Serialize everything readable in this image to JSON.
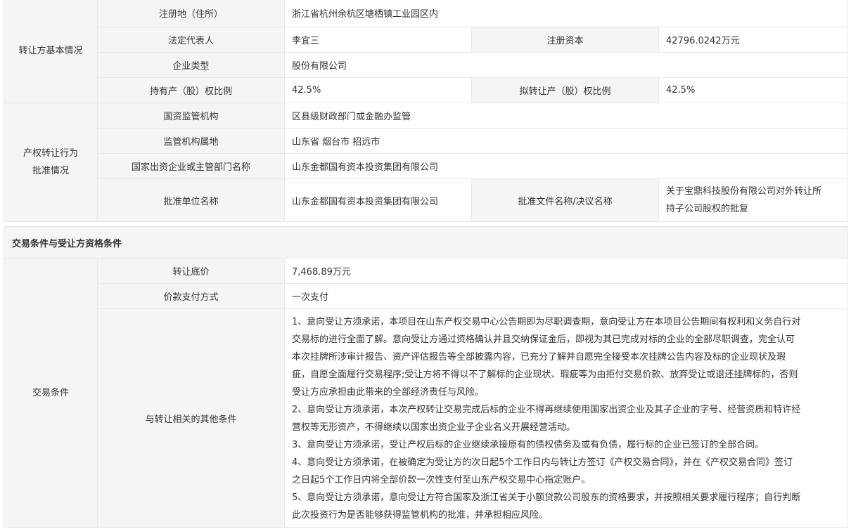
{
  "transferor": {
    "group_label": "转让方基本情况",
    "reg_address_label": "注册地（住所）",
    "reg_address": "浙江省杭州余杭区塘栖镇工业园区内",
    "legal_rep_label": "法定代表人",
    "legal_rep": "李宜三",
    "reg_capital_label": "注册资本",
    "reg_capital": "42796.0242万元",
    "company_type_label": "企业类型",
    "company_type": "股份有限公司",
    "holding_ratio_label": "持有产（股）权比例",
    "holding_ratio": "42.5%",
    "transfer_ratio_label": "拟转让产（股）权比例",
    "transfer_ratio": "42.5%"
  },
  "approval": {
    "group_label_line1": "产权转让行为",
    "group_label_line2": "批准情况",
    "supervisor_label": "国资监管机构",
    "supervisor": "区县级财政部门或金融办监管",
    "supervisor_location_label": "监管机构属地",
    "supervisor_location": "山东省 烟台市 招远市",
    "investor_label": "国家出资企业或主管部门名称",
    "investor": "山东金都国有资本投资集团有限公司",
    "approver_label": "批准单位名称",
    "approver": "山东金都国有资本投资集团有限公司",
    "approval_doc_label": "批准文件名称/决议名称",
    "approval_doc_line1": "关于宝鼎科技股份有限公司对外转让所",
    "approval_doc_line2": "持子公司股权的批复"
  },
  "trade": {
    "section_title": "交易条件与受让方资格条件",
    "group_label": "交易条件",
    "base_price_label": "转让底价",
    "base_price": "7,468.89万元",
    "payment_label": "价款支付方式",
    "payment": "一次支付",
    "other_conditions_label": "与转让相关的其他条件",
    "other_conditions": [
      "1、意向受让方须承诺，本项目在山东产权交易中心公告期即为尽职调查期，意向受让方在本项目公告期间有权利和义务自行对",
      "交易标的进行全面了解。意向受让方通过资格确认并且交纳保证金后，即视为其已完成对标的企业的全部尽职调查，完全认可",
      "本次挂牌所涉审计报告、资产评估报告等全部披露内容，已充分了解并自愿完全接受本次挂牌公告内容及标的企业现状及瑕",
      "疵，自愿全面履行交易程序;受让方将不得以不了解标的企业现状、瑕疵等为由拒付交易价款、放弃受让或退还挂牌标的，否则",
      "受让方应承担由此带来的全部经济责任与风险。",
      "2、意向受让方须承诺，本次产权转让交易完成后标的企业不得再继续使用国家出资企业及其子企业的字号、经营资质和特许经",
      "营权等无形资产，不得继续以国家出资企业子企业名义开展经营活动。",
      "3、意向受让方须承诺，受让产权后标的企业继续承接原有的债权债务及或有负债，履行标的企业已签订的全部合同。",
      "4、意向受让方须承诺，在被确定为受让方的次日起5个工作日内与转让方签订《产权交易合同》，并在《产权交易合同》签订",
      "之日起5个工作日内将全部价款一次性支付至山东产权交易中心指定账户。",
      "5、意向受让方须承诺，意向受让方符合国家及浙江省关于小额贷款公司股东的资格要求，并按照相关要求履行程序；自行判断",
      "此次投资行为是否能够获得监管机构的批准，并承担相应风险。"
    ]
  }
}
